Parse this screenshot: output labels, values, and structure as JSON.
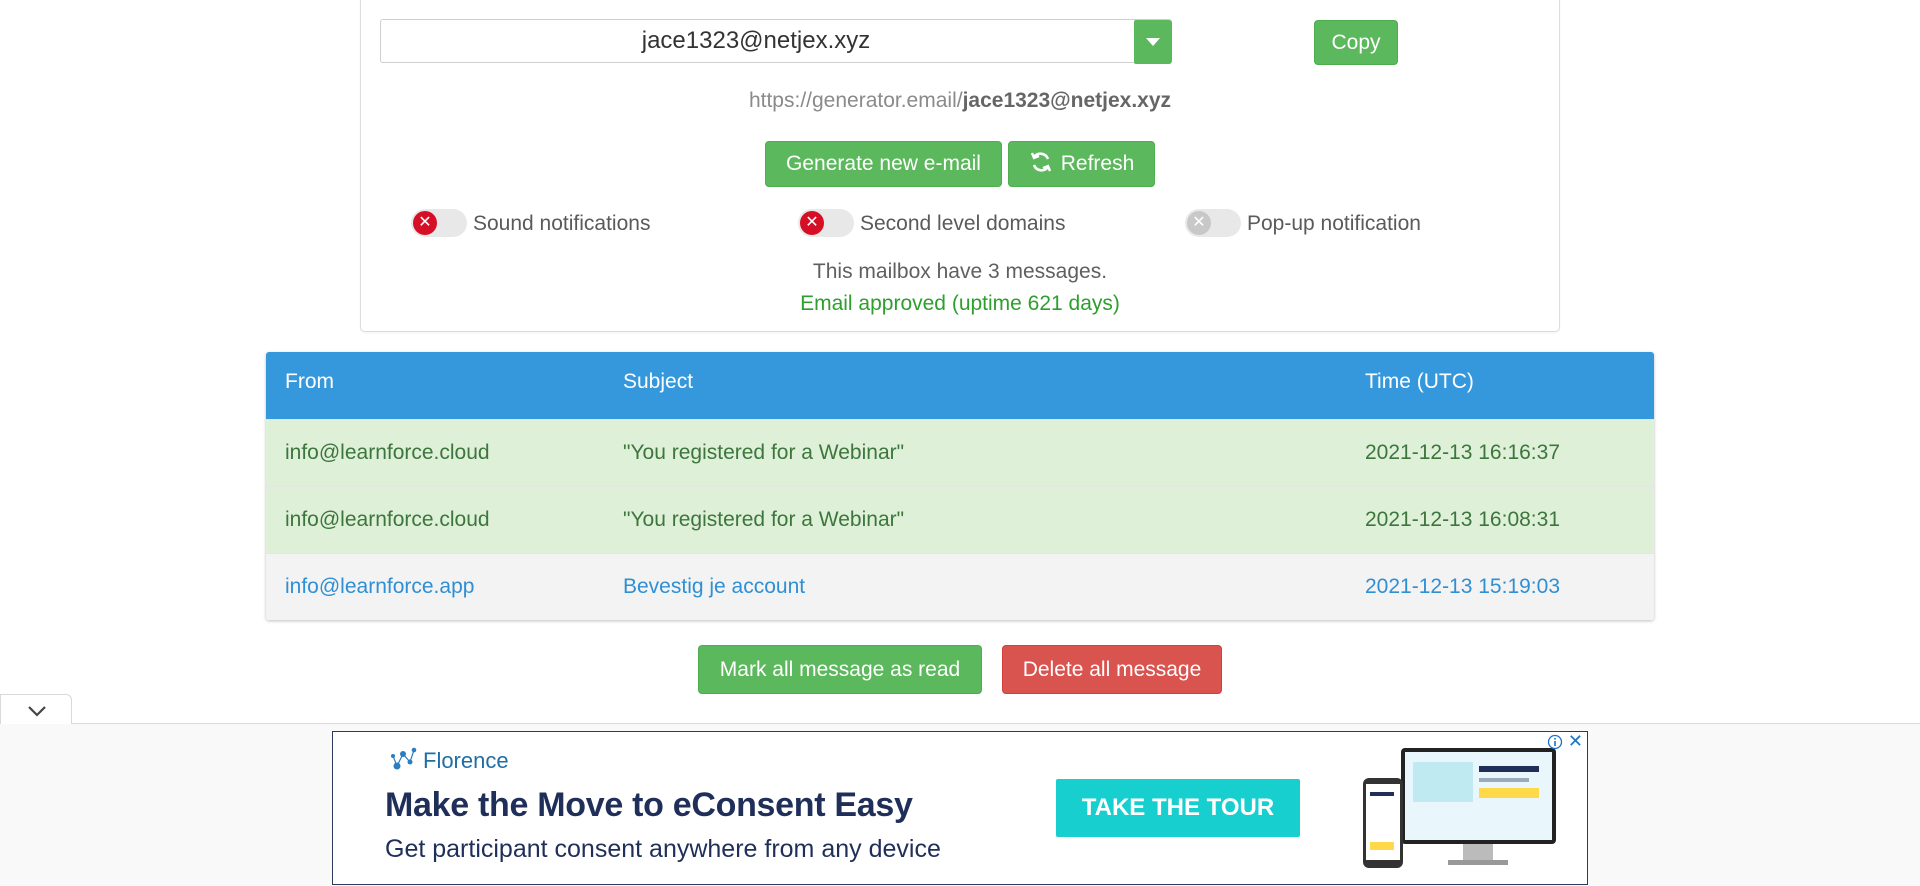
{
  "generator": {
    "email": "jace1323@netjex.xyz",
    "copy_label": "Copy",
    "url_prefix": "https://generator.email/",
    "url_email": "jace1323@netjex.xyz",
    "generate_label": "Generate new e-mail",
    "refresh_label": "Refresh"
  },
  "toggles": [
    {
      "label": "Sound notifications",
      "state": "off"
    },
    {
      "label": "Second level domains",
      "state": "off"
    },
    {
      "label": "Pop-up notification",
      "state": "disabled"
    }
  ],
  "status": {
    "mailbox_count": "This mailbox have 3 messages.",
    "approved": "Email approved (uptime 621 days)",
    "approved_color": "#2e9e2e"
  },
  "table": {
    "headers": [
      "From",
      "Subject",
      "Time (UTC)"
    ],
    "header_color": "#3598dc",
    "rows": [
      {
        "from": "info@learnforce.cloud",
        "subject": "\"You registered for a Webinar\"",
        "time": "2021-12-13 16:16:37",
        "read": true
      },
      {
        "from": "info@learnforce.cloud",
        "subject": "\"You registered for a Webinar\"",
        "time": "2021-12-13 16:08:31",
        "read": true
      },
      {
        "from": "info@learnforce.app",
        "subject": "Bevestig je account",
        "time": "2021-12-13 15:19:03",
        "read": false
      }
    ]
  },
  "actions": {
    "mark_all_label": "Mark all message as read",
    "delete_all_label": "Delete all message"
  },
  "ad": {
    "brand": "Florence",
    "headline": "Make the Move to eConsent Easy",
    "subline": "Get participant consent anywhere from any device",
    "cta": "TAKE THE TOUR",
    "close": "✕",
    "info": "i",
    "cta_color": "#18cfcf"
  },
  "icons": {
    "dropdown": "caret-down-icon",
    "refresh": "refresh-icon",
    "collapse": "chevron-down-icon",
    "toggle_off": "x-icon"
  }
}
